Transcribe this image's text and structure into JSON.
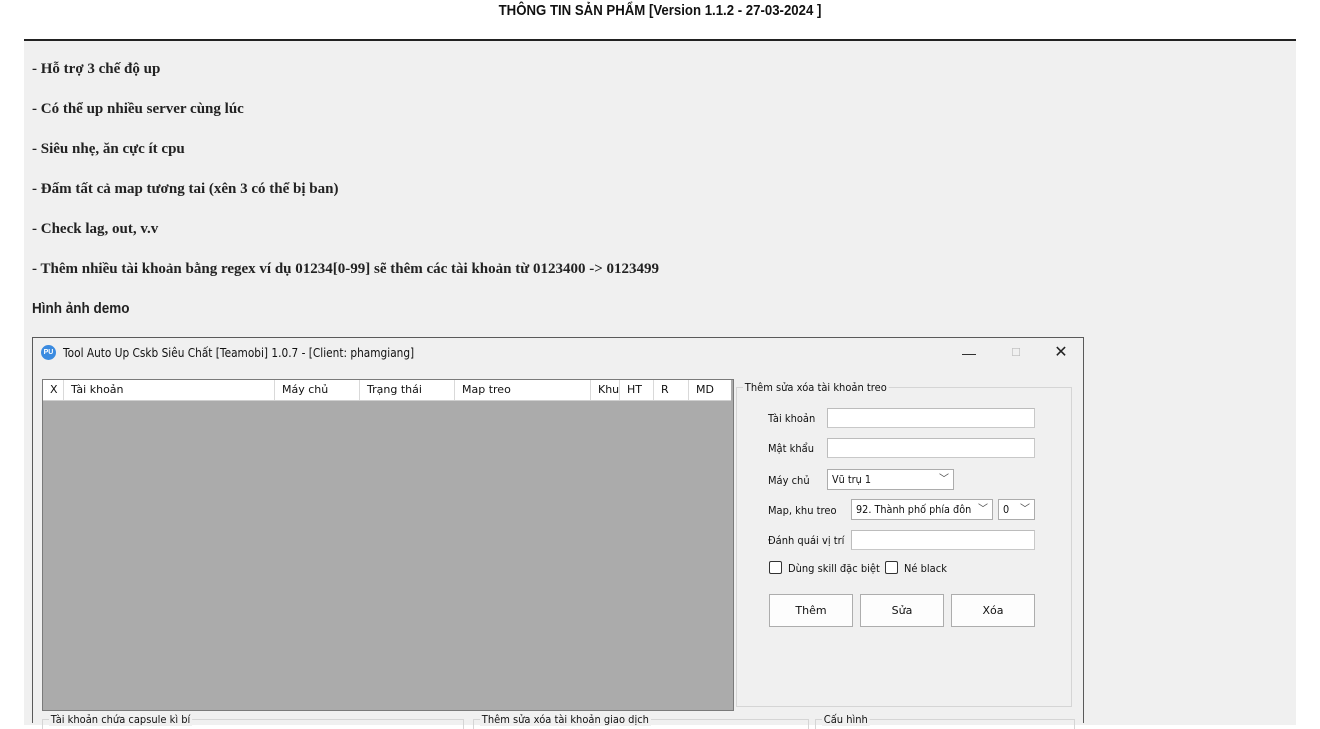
{
  "page": {
    "title": "THÔNG TIN SẢN PHẨM [Version 1.1.2 - 27-03-2024 ]",
    "features": [
      "- Hỗ trợ 3 chế độ up",
      "- Có thể up nhiều server cùng lúc",
      "- Siêu nhẹ, ăn cực ít cpu",
      "- Đấm tất cả map tương tai (xên 3 có thể bị ban)",
      "- Check lag, out, v.v",
      "- Thêm nhiều tài khoản bằng regex ví dụ 01234[0-99] sẽ thêm các tài khoản từ 0123400 -> 0123499"
    ],
    "demo_heading": "Hình ảnh demo"
  },
  "app": {
    "logo_text": "PU",
    "window_title": "Tool Auto Up Cskb Siêu Chất [Teamobi] 1.0.7 - [Client: phamgiang]",
    "window_buttons": {
      "minimize": "—",
      "maximize": "☐",
      "close": "✕"
    },
    "grid": {
      "columns": [
        "X",
        "Tài khoản",
        "Máy chủ",
        "Trạng thái",
        "Map treo",
        "Khu",
        "HT",
        "R",
        "MD"
      ]
    },
    "account_form": {
      "legend": "Thêm sửa xóa tài khoản treo",
      "account_label": "Tài khoản",
      "account_value": "",
      "password_label": "Mật khẩu",
      "password_value": "",
      "server_label": "Máy chủ",
      "server_selected": "Vũ trụ 1",
      "map_label": "Map, khu treo",
      "map_selected": "92. Thành phố phía đôn",
      "zone_selected": "0",
      "position_label": "Đánh quái vị trí",
      "position_value": "",
      "special_skill_label": "Dùng skill đặc biệt",
      "avoid_black_label": "Né black",
      "add_button": "Thêm",
      "edit_button": "Sửa",
      "delete_button": "Xóa"
    },
    "bottom_groups": {
      "capsule_title": "Tài khoản chứa capsule kì bí",
      "trade_title": "Thêm sửa xóa tài khoản giao dịch",
      "config_title": "Cấu hình"
    }
  }
}
